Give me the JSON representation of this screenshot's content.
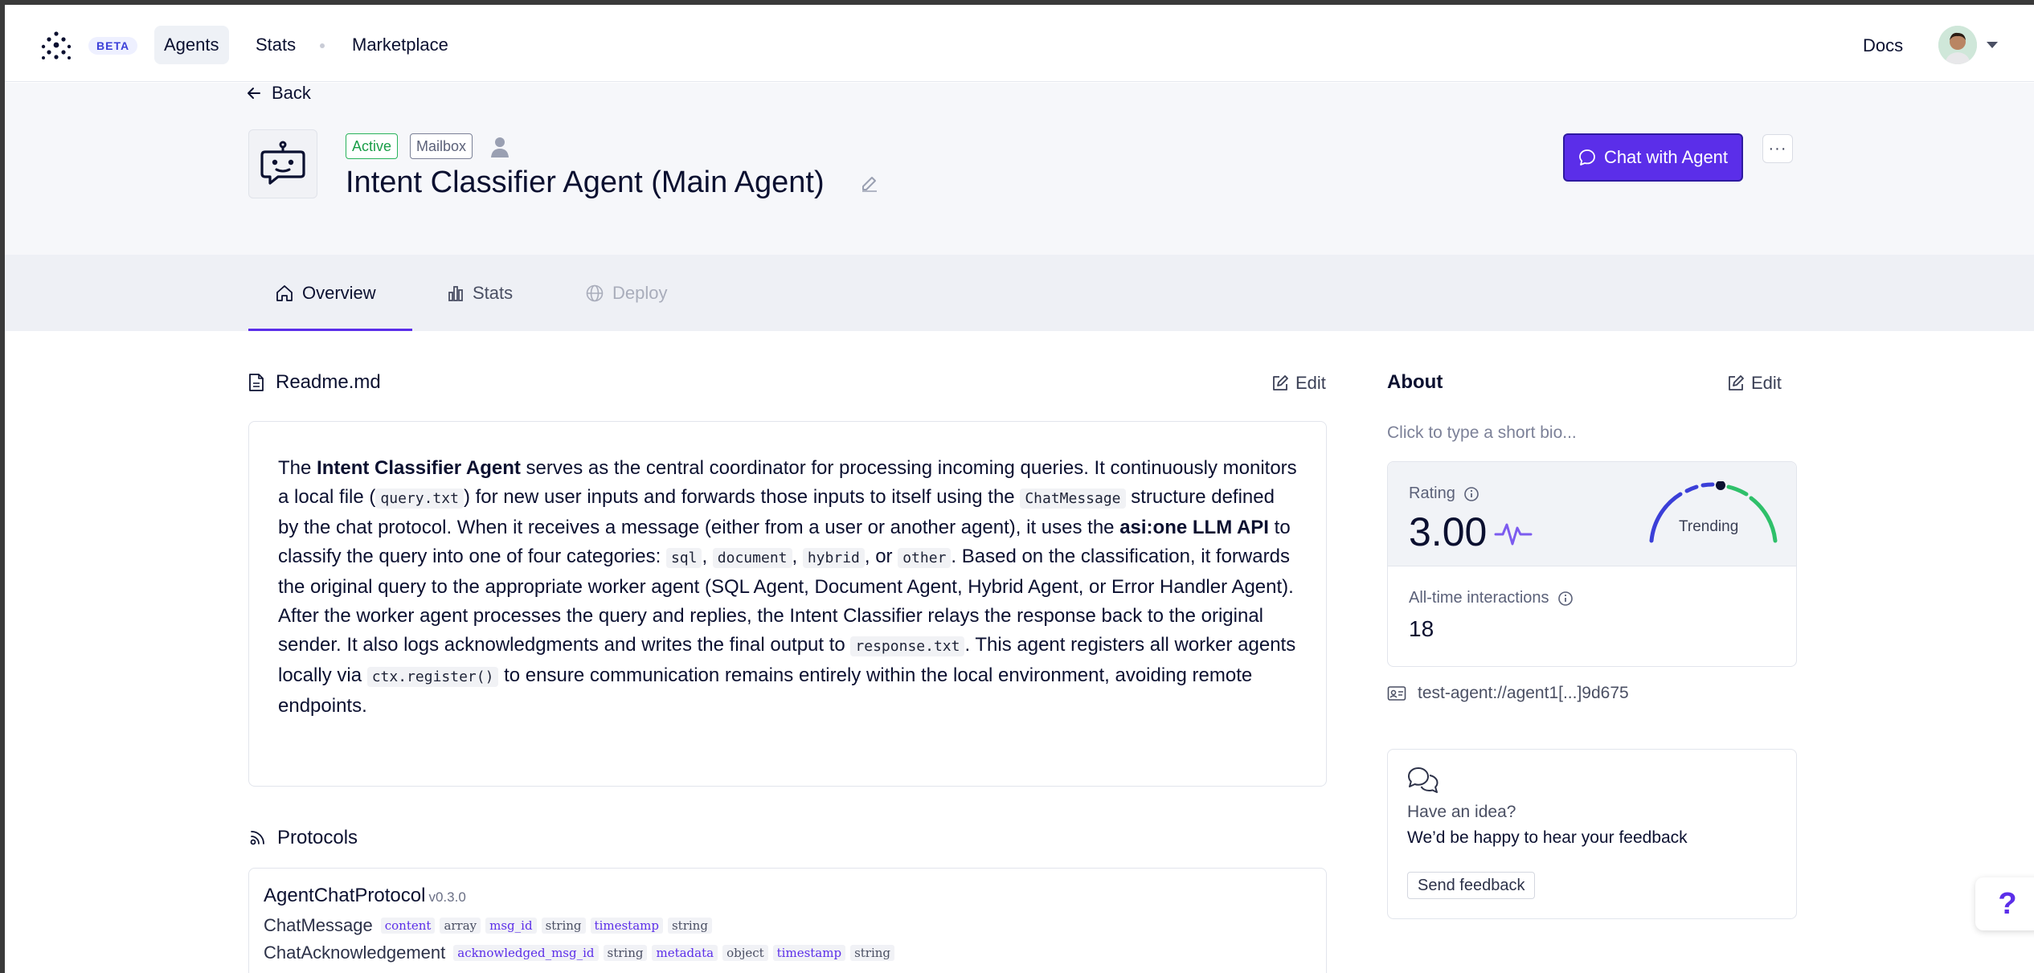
{
  "nav": {
    "beta": "BETA",
    "agents": "Agents",
    "stats": "Stats",
    "marketplace": "Marketplace",
    "docs": "Docs"
  },
  "header": {
    "back": "Back",
    "status": "Active",
    "mailbox": "Mailbox",
    "title": "Intent Classifier Agent (Main Agent)",
    "chat_button": "Chat with Agent",
    "more": "···"
  },
  "tabs": [
    {
      "label": "Overview",
      "icon": "home-icon",
      "active": true
    },
    {
      "label": "Stats",
      "icon": "bar-chart-icon",
      "active": false
    },
    {
      "label": "Deploy",
      "icon": "globe-icon",
      "disabled": true
    }
  ],
  "readme": {
    "title": "Readme.md",
    "edit": "Edit",
    "text": [
      "The ",
      "Intent Classifier Agent",
      " serves as the central coordinator for processing incoming queries. It continuously monitors a local file (",
      "query.txt",
      ") for new user inputs and forwards those inputs to itself using the ",
      "ChatMessage",
      " structure defined by the chat protocol. When it receives a message (either from a user or another agent), it uses the ",
      "asi:one LLM API",
      " to classify the query into one of four categories: ",
      "sql",
      ", ",
      "document",
      ", ",
      "hybrid",
      ", or ",
      "other",
      ". Based on the classification, it forwards the original query to the appropriate worker agent (SQL Agent, Document Agent, Hybrid Agent, or Error Handler Agent). After the worker agent processes the query and replies, the Intent Classifier relays the response back to the original sender. It also logs acknowledgments and writes the final output to ",
      "response.txt",
      ". This agent registers all worker agents locally via ",
      "ctx.register()",
      " to ensure communication remains entirely within the local environment, avoiding remote endpoints."
    ]
  },
  "protocols": {
    "title": "Protocols",
    "name": "AgentChatProtocol",
    "version": "v0.3.0",
    "messages": [
      {
        "name": "ChatMessage",
        "fields": [
          [
            "content",
            "array"
          ],
          [
            "msg_id",
            "string"
          ],
          [
            "timestamp",
            "string"
          ]
        ]
      },
      {
        "name": "ChatAcknowledgement",
        "fields": [
          [
            "acknowledged_msg_id",
            "string"
          ],
          [
            "metadata",
            "object"
          ],
          [
            "timestamp",
            "string"
          ]
        ]
      }
    ]
  },
  "about": {
    "title": "About",
    "edit": "Edit",
    "bio_placeholder": "Click to type a short bio...",
    "rating_label": "Rating",
    "rating": "3.00",
    "trending": "Trending",
    "interactions_label": "All-time interactions",
    "interactions": "18",
    "address": "test-agent://agent1[...]9d675"
  },
  "feedback": {
    "question": "Have an idea?",
    "text": "We’d be happy to hear your feedback",
    "button": "Send feedback"
  },
  "help": "?",
  "colors": {
    "accent": "#5b2ee9",
    "active_green": "#1a9e48",
    "gauge_blue": "#3b3fd8",
    "gauge_green": "#2fc06a"
  }
}
